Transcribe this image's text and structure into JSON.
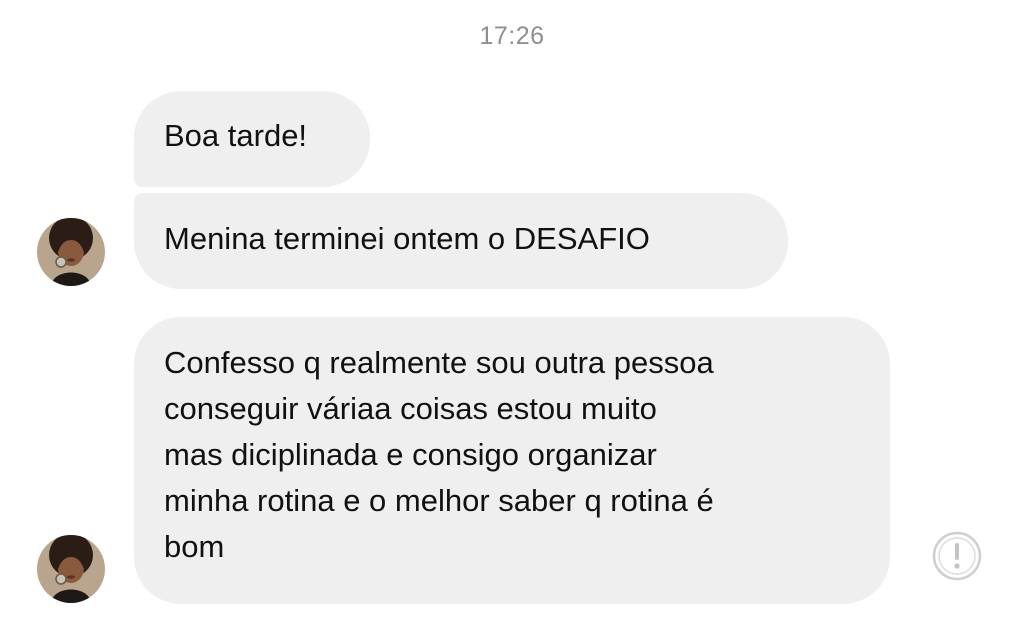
{
  "timestamp": "17:26",
  "messages": [
    {
      "text": "Boa tarde!"
    },
    {
      "text": "Menina terminei ontem o DESAFIO"
    },
    {
      "lines": [
        "Confesso q realmente sou outra pessoa",
        "conseguir váriaa coisas estou muito",
        "mas diciplinada e consigo organizar",
        "minha rotina e o melhor saber q rotina é",
        "bom"
      ]
    }
  ],
  "icons": {
    "avatar": "user-avatar",
    "alert": "exclamation-circle-icon"
  },
  "colors": {
    "bubble_bg": "#efefef",
    "timestamp": "#8e8e93",
    "text": "#111111"
  }
}
